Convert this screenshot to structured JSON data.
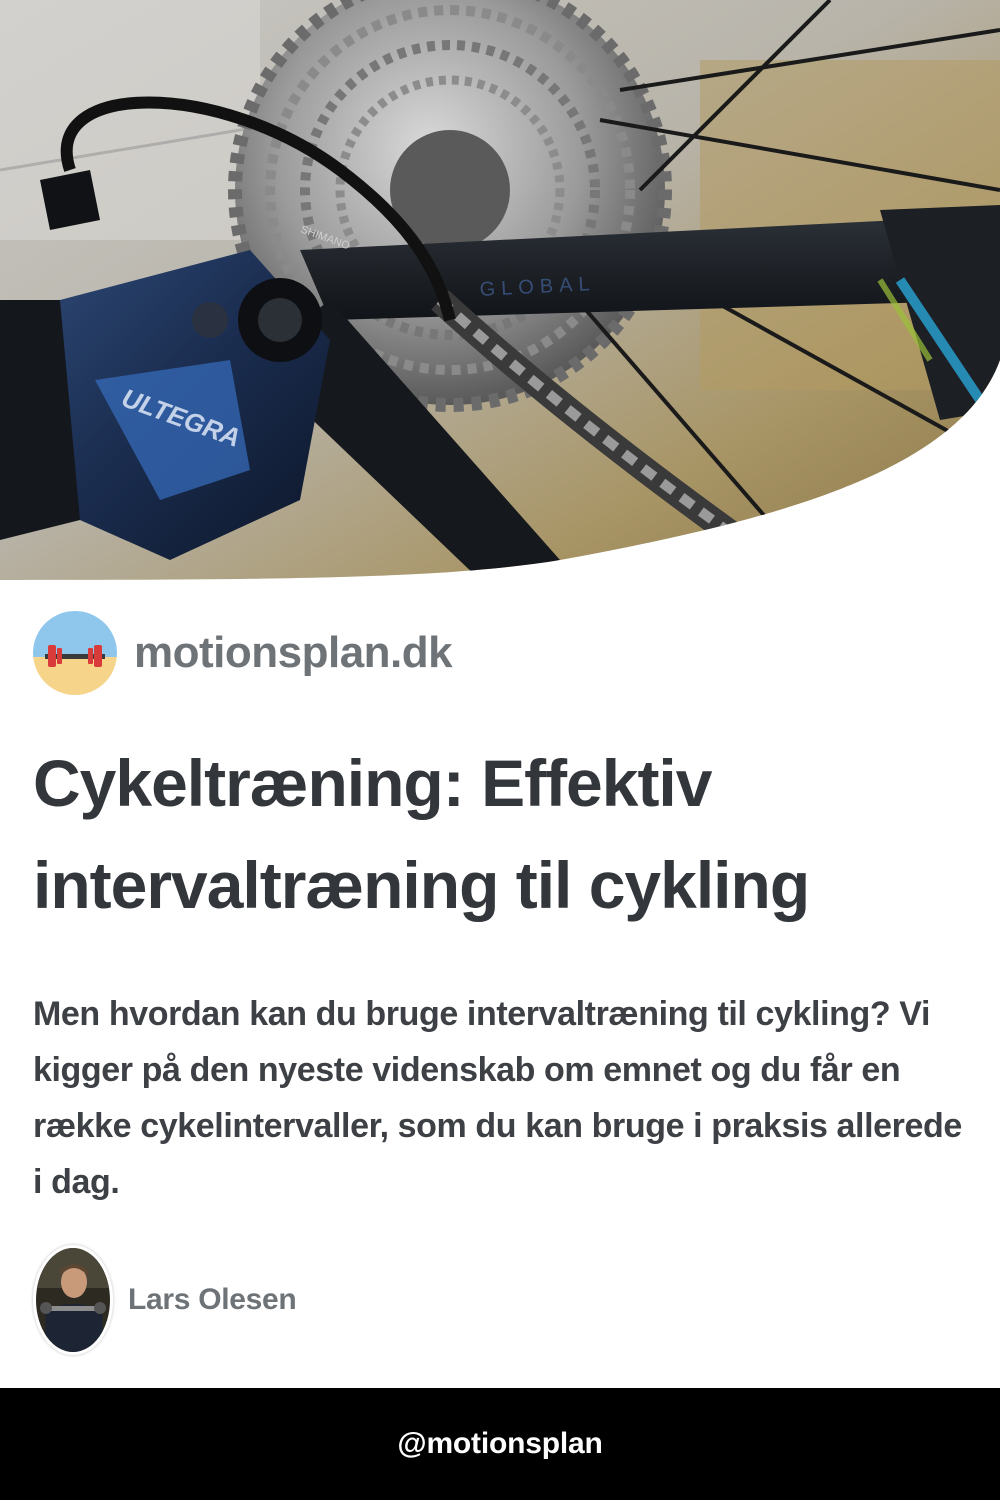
{
  "hero": {
    "image": "bicycle-rear-derailleur-cassette-photo",
    "brand_marks": [
      "SHIMANO",
      "GLOBAL"
    ]
  },
  "site": {
    "logo_icon": "barbell-beach-icon",
    "name": "motionsplan.dk"
  },
  "article": {
    "title": "Cykeltræning: Effektiv intervaltræning til cykling",
    "description": "Men hvordan kan du bruge intervaltræning til cykling? Vi kigger på den nyeste videnskab om emnet og du får en række cykelintervaller, som du kan bruge i praksis allerede i dag."
  },
  "author": {
    "avatar_icon": "author-photo-avatar",
    "name": "Lars Olesen"
  },
  "footer": {
    "handle": "@motionsplan"
  },
  "colors": {
    "title": "#33373b",
    "text": "#3d4145",
    "muted": "#6e7378",
    "footer_bg": "#000000",
    "footer_text": "#ffffff"
  }
}
